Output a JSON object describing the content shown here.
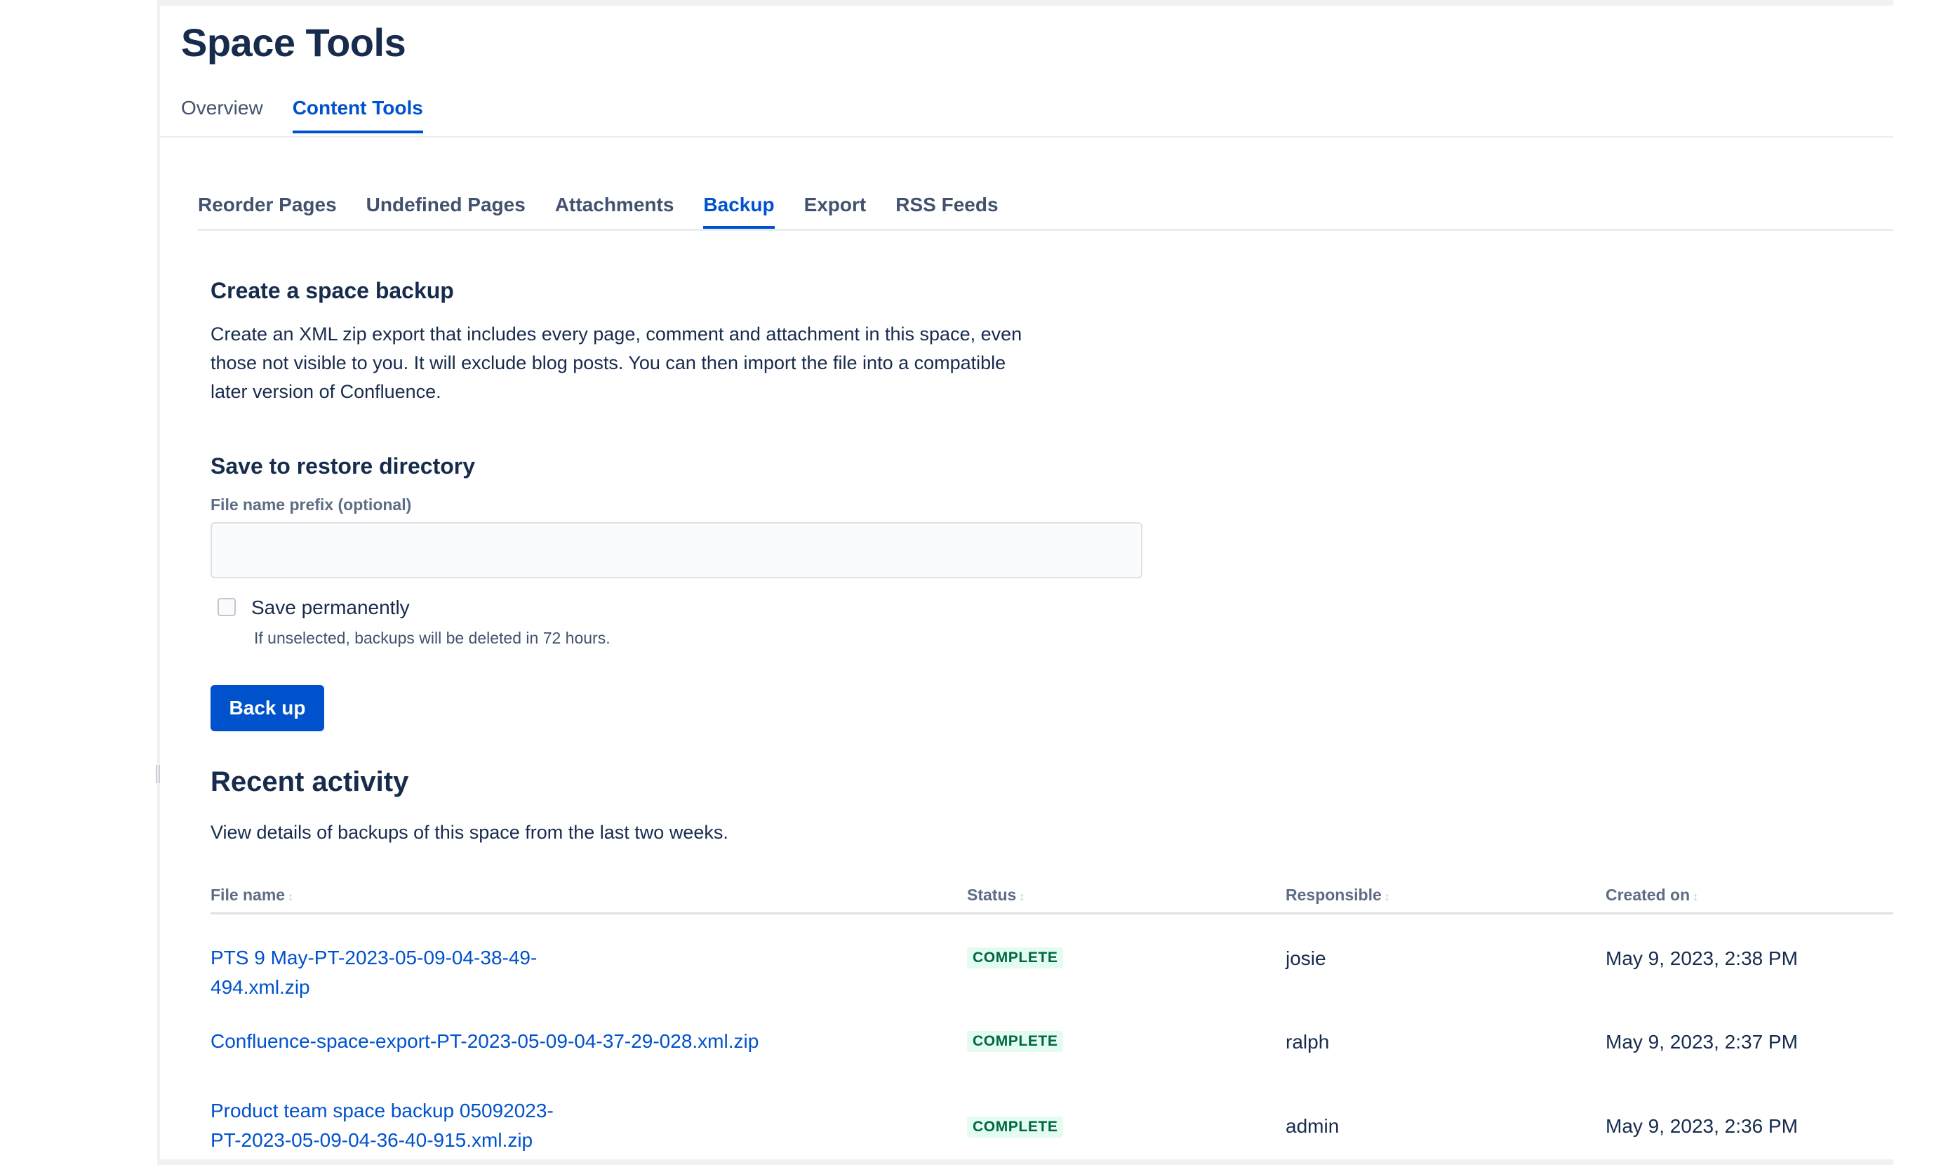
{
  "header": {
    "title": "Space Tools",
    "tabs": [
      {
        "label": "Overview",
        "active": false
      },
      {
        "label": "Content Tools",
        "active": true
      }
    ]
  },
  "subtabs": [
    {
      "label": "Reorder Pages",
      "active": false
    },
    {
      "label": "Undefined Pages",
      "active": false
    },
    {
      "label": "Attachments",
      "active": false
    },
    {
      "label": "Backup",
      "active": true
    },
    {
      "label": "Export",
      "active": false
    },
    {
      "label": "RSS Feeds",
      "active": false
    }
  ],
  "backup": {
    "heading": "Create a space backup",
    "description_lines": [
      "Create an XML zip export that includes every page, comment and attachment in this space, even",
      "those not visible to you. It will exclude blog posts. You can then import the file into a compatible",
      "later version of Confluence."
    ],
    "restore_heading": "Save to restore directory",
    "prefix_label": "File name prefix (optional)",
    "prefix_value": "",
    "save_permanently_label": "Save permanently",
    "save_permanently_checked": false,
    "save_permanently_help": "If unselected, backups will be deleted in 72 hours.",
    "backup_button": "Back up"
  },
  "recent": {
    "heading": "Recent activity",
    "description": "View details of backups of this space from the last two weeks.",
    "columns": {
      "file_name": "File name",
      "status": "Status",
      "responsible": "Responsible",
      "created_on": "Created on"
    },
    "sort_glyph": "↕",
    "rows": [
      {
        "file_lines": [
          "PTS 9 May-PT-2023-05-09-04-38-49-494.xml.zip"
        ],
        "status": "COMPLETE",
        "responsible": "josie",
        "created_on": "May 9, 2023, 2:38 PM"
      },
      {
        "file_lines": [
          "Confluence-space-export-PT-2023-05-09-04-37-29-028.xml.zip"
        ],
        "status": "COMPLETE",
        "responsible": "ralph",
        "created_on": "May 9, 2023, 2:37 PM"
      },
      {
        "file_lines": [
          "Product team space backup 05092023-",
          "PT-2023-05-09-04-36-40-915.xml.zip"
        ],
        "status": "COMPLETE",
        "responsible": "admin",
        "created_on": "May 9, 2023, 2:36 PM"
      }
    ]
  },
  "colors": {
    "primary": "#0052cc",
    "text": "#172b4d",
    "subtle": "#5e6c84",
    "success_bg": "#e3fcef",
    "success_text": "#006644"
  }
}
